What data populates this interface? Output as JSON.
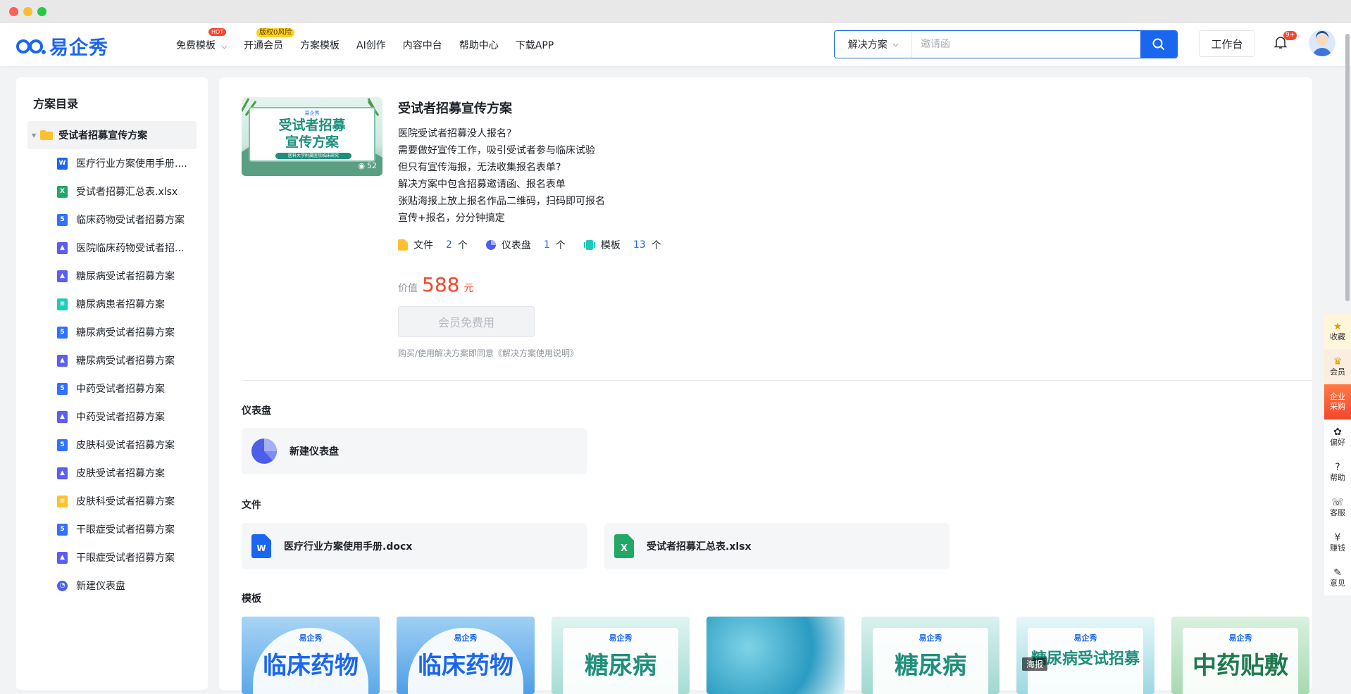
{
  "app": {
    "logo_text": "易企秀"
  },
  "nav": [
    {
      "label": "免费模板",
      "badge": "HOT"
    },
    {
      "label": "开通会员",
      "badge": "版权0风险"
    },
    {
      "label": "方案模板"
    },
    {
      "label": "AI创作"
    },
    {
      "label": "内容中台"
    },
    {
      "label": "帮助中心"
    },
    {
      "label": "下载APP"
    }
  ],
  "search": {
    "category": "解决方案",
    "placeholder": "邀请函"
  },
  "header": {
    "workbench": "工作台",
    "notif_badge": "9+"
  },
  "sidebar": {
    "title": "方案目录",
    "folder": "受试者招募宣传方案",
    "items": [
      {
        "label": "医疗行业方案使用手册....",
        "type": "word"
      },
      {
        "label": "受试者招募汇总表.xlsx",
        "type": "excel"
      },
      {
        "label": "临床药物受试者招募方案",
        "type": "h5"
      },
      {
        "label": "医院临床药物受试者招...",
        "type": "image"
      },
      {
        "label": "糖尿病受试者招募方案",
        "type": "image"
      },
      {
        "label": "糖尿病患者招募方案",
        "type": "form"
      },
      {
        "label": "糖尿病受试者招募方案",
        "type": "h5"
      },
      {
        "label": "糖尿病受试者招募方案",
        "type": "image"
      },
      {
        "label": "中药受试者招募方案",
        "type": "h5"
      },
      {
        "label": "中药受试者招募方案",
        "type": "image"
      },
      {
        "label": "皮肤科受试者招募方案",
        "type": "h5"
      },
      {
        "label": "皮肤受试者招募方案",
        "type": "image"
      },
      {
        "label": "皮肤科受试者招募方案",
        "type": "doc"
      },
      {
        "label": "干眼症受试者招募方案",
        "type": "h5"
      },
      {
        "label": "干眼症受试者招募方案",
        "type": "image"
      },
      {
        "label": "新建仪表盘",
        "type": "dashboard"
      }
    ]
  },
  "solution": {
    "cover_brand": "易企秀",
    "cover_title_1": "受试者招募",
    "cover_title_2": "宣传方案",
    "cover_sub": "医科大学附属医院临床研究",
    "views": "52",
    "title": "受试者招募宣传方案",
    "desc": [
      "医院受试者招募没人报名?",
      "需要做好宣传工作，吸引受试者参与临床试验",
      "但只有宣传海报，无法收集报名表单?",
      "解决方案中包含招募邀请函、报名表单",
      "张贴海报上放上报名作品二维码，扫码即可报名",
      "宣传+报名，分分钟搞定"
    ],
    "stats": [
      {
        "label": "文件",
        "count": "2",
        "unit": "个"
      },
      {
        "label": "仪表盘",
        "count": "1",
        "unit": "个"
      },
      {
        "label": "模板",
        "count": "13",
        "unit": "个"
      }
    ],
    "price_label": "价值",
    "price": "588",
    "price_unit": "元",
    "free_button": "会员免费用",
    "agreement": "购买/使用解决方案即同意《解决方案使用说明》"
  },
  "sections": {
    "dashboard_title": "仪表盘",
    "dashboard_card": "新建仪表盘",
    "files_title": "文件",
    "files": [
      "医疗行业方案使用手册.docx",
      "受试者招募汇总表.xlsx"
    ],
    "templates_title": "模板"
  },
  "templates": [
    {
      "brand": "易企秀",
      "text": "临床药物"
    },
    {
      "brand": "易企秀",
      "text": "临床药物"
    },
    {
      "brand": "易企秀",
      "text": "糖尿病"
    },
    {
      "brand": "",
      "text": ""
    },
    {
      "brand": "易企秀",
      "text": "糖尿病"
    },
    {
      "brand": "易企秀",
      "text": "糖尿病受试招募",
      "tag": "海报"
    },
    {
      "brand": "易企秀",
      "text": "中药贴敷"
    }
  ],
  "rail": [
    "收藏",
    "会员",
    "企业\n采购",
    "偏好",
    "帮助",
    "客服",
    "赚钱",
    "意见"
  ]
}
